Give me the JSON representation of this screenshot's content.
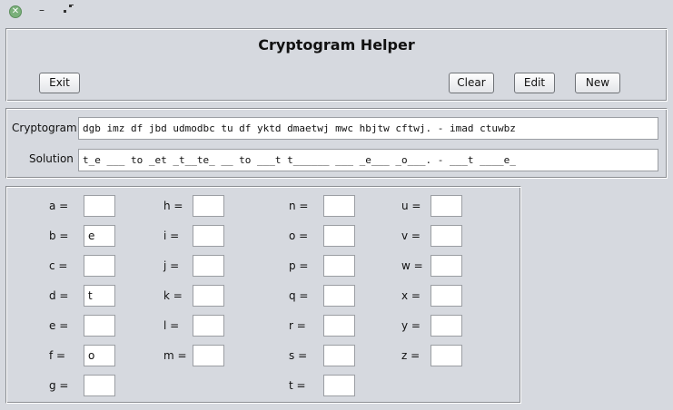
{
  "window": {
    "close_glyph": "✕",
    "minimize_glyph": "–"
  },
  "header": {
    "title": "Cryptogram Helper",
    "buttons": {
      "exit": "Exit",
      "clear": "Clear",
      "edit": "Edit",
      "new": "New"
    }
  },
  "cryptogram": {
    "label": "Cryptogram",
    "value": "dgb imz df jbd udmodbc tu df yktd dmaetwj mwc hbjtw cftwj. - imad ctuwbz"
  },
  "solution": {
    "label": "Solution",
    "value": "t_e ___ to _et _t__te_ __ to ___t t______ ___ _e___ _o___. - ___t ____e_"
  },
  "letters": {
    "a": {
      "label": "a =",
      "value": ""
    },
    "b": {
      "label": "b =",
      "value": "e"
    },
    "c": {
      "label": "c =",
      "value": ""
    },
    "d": {
      "label": "d =",
      "value": "t"
    },
    "e": {
      "label": "e =",
      "value": ""
    },
    "f": {
      "label": "f =",
      "value": "o"
    },
    "g": {
      "label": "g =",
      "value": ""
    },
    "h": {
      "label": "h =",
      "value": ""
    },
    "i": {
      "label": "i =",
      "value": ""
    },
    "j": {
      "label": "j =",
      "value": ""
    },
    "k": {
      "label": "k =",
      "value": ""
    },
    "l": {
      "label": "l =",
      "value": ""
    },
    "m": {
      "label": "m =",
      "value": ""
    },
    "n": {
      "label": "n =",
      "value": ""
    },
    "o": {
      "label": "o =",
      "value": ""
    },
    "p": {
      "label": "p =",
      "value": ""
    },
    "q": {
      "label": "q =",
      "value": ""
    },
    "r": {
      "label": "r =",
      "value": ""
    },
    "s": {
      "label": "s =",
      "value": ""
    },
    "t": {
      "label": "t =",
      "value": ""
    },
    "u": {
      "label": "u =",
      "value": ""
    },
    "v": {
      "label": "v =",
      "value": ""
    },
    "w": {
      "label": "w =",
      "value": ""
    },
    "x": {
      "label": "x =",
      "value": ""
    },
    "y": {
      "label": "y =",
      "value": ""
    },
    "z": {
      "label": "z =",
      "value": ""
    }
  }
}
